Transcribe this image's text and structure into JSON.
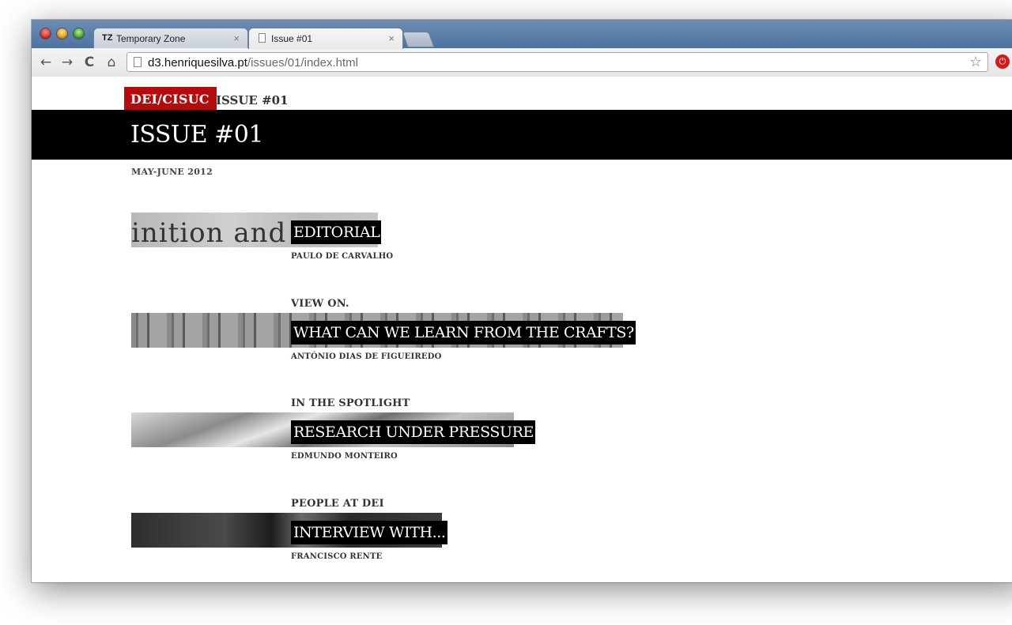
{
  "browser": {
    "tabs": [
      {
        "favicon": "TZ",
        "title": "Temporary Zone",
        "close": "×"
      },
      {
        "favicon": "page-icon",
        "title": "Issue #01",
        "close": "×"
      }
    ],
    "url_host": "d3.henriquesilva.pt",
    "url_path": "/issues/01/index.html",
    "icons": {
      "back": "←",
      "forward": "→",
      "reload": "C",
      "home": "⌂",
      "star": "☆"
    }
  },
  "site": {
    "brand": "DEI/CISUC",
    "breadcrumb": "ISSUE #01",
    "title": "ISSUE #01",
    "date": "MAY-JUNE 2012"
  },
  "articles": [
    {
      "kicker": "",
      "title": "EDITORIAL",
      "author": "PAULO DE CARVALHO",
      "thumb_text": "inition  and  B"
    },
    {
      "kicker": "VIEW ON.",
      "title": "WHAT CAN WE LEARN FROM THE CRAFTS?",
      "author": "ANTÓNIO DIAS DE FIGUEIREDO"
    },
    {
      "kicker": "IN THE SPOTLIGHT",
      "title": "RESEARCH UNDER PRESSURE",
      "author": "EDMUNDO MONTEIRO"
    },
    {
      "kicker": "PEOPLE AT DEI",
      "title": "INTERVIEW WITH...",
      "author": "FRANCISCO RENTE"
    }
  ],
  "colors": {
    "brand": "#b50b0b",
    "header": "#000000"
  }
}
